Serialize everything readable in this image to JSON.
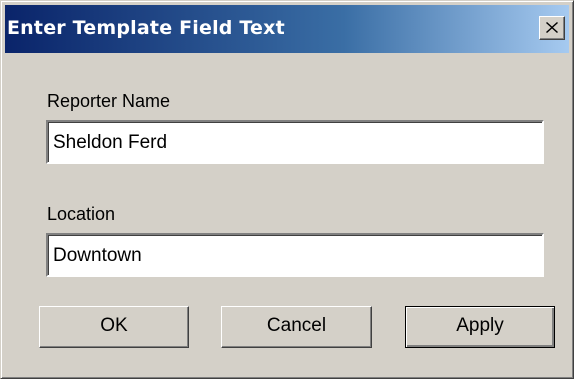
{
  "window": {
    "title": "Enter Template Field Text",
    "close_icon": "close-icon"
  },
  "fields": [
    {
      "label": "Reporter Name",
      "value": "Sheldon Ferd"
    },
    {
      "label": "Location",
      "value": "Downtown"
    }
  ],
  "buttons": {
    "ok": "OK",
    "cancel": "Cancel",
    "apply": "Apply"
  },
  "colors": {
    "face": "#d4d0c8",
    "title_start": "#0a246a",
    "title_end": "#a6caf0"
  }
}
